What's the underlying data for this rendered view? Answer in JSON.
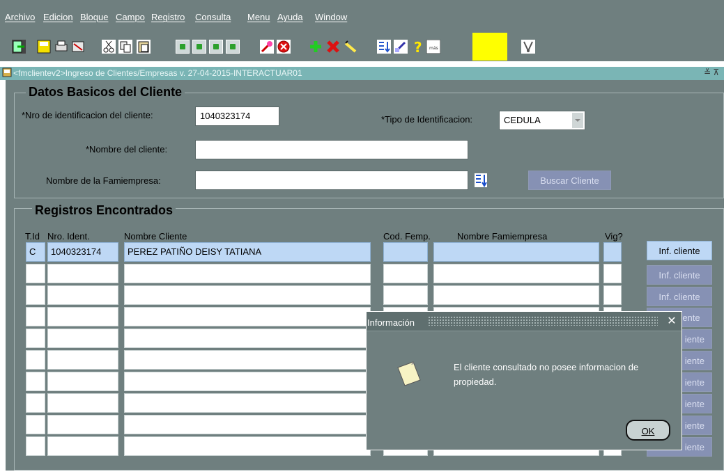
{
  "menu": [
    "Archivo",
    "Edicion",
    "Bloque",
    "Campo",
    "Registro",
    "Consulta",
    "Menu",
    "Ayuda",
    "Window"
  ],
  "toolbar_icons": [
    "exit-icon",
    "save-icon",
    "print-icon",
    "clear-icon",
    "cut-icon",
    "copy-icon",
    "paste-icon",
    "first-record-icon",
    "previous-block-icon",
    "next-block-icon",
    "last-record-icon",
    "enter-query-icon",
    "cancel-query-icon",
    "insert-record-icon",
    "delete-record-icon",
    "edit-icon",
    "list-icon",
    "notes-icon",
    "help-icon",
    "more-icon",
    "highlight-box",
    "tools-icon"
  ],
  "window": {
    "title": "<fmclientev2>Ingreso de Clientes/Empresas v. 27-04-2015-INTERACTUAR01",
    "controls": "≚ ⊼"
  },
  "basic": {
    "section_title": "Datos Basicos del Cliente",
    "id_label": "*Nro de identificacion del cliente:",
    "id_value": "1040323174",
    "tipo_label": "*Tipo de Identificacion:",
    "tipo_value": "CEDULA",
    "nombre_label": "*Nombre del cliente:",
    "nombre_value": "",
    "famiempresa_label": "Nombre de la Famiempresa:",
    "famiempresa_value": "",
    "buscar_button": "Buscar Cliente"
  },
  "registros": {
    "section_title": "Registros Encontrados",
    "headers": [
      "T.Id",
      "Nro. Ident.",
      "Nombre Cliente",
      "Cod. Femp.",
      "Nombre Famiempresa",
      "Vig?"
    ],
    "rows": [
      {
        "tid": "C",
        "nro": "1040323174",
        "nombre": "PEREZ PATIÑO DEISY TATIANA",
        "cod": "",
        "famiempresa": "",
        "vig": ""
      }
    ],
    "inf_button": "Inf. cliente",
    "visible_inf_top": [
      "Inf. cliente",
      "Inf. cliente",
      "Inf. cliente"
    ],
    "visible_inf_partial": [
      "iente",
      "iente",
      "iente",
      "iente",
      "iente",
      "iente",
      "iente",
      "iente"
    ]
  },
  "dialog": {
    "title": "Información",
    "close": "✕",
    "message": "El cliente consultado no posee informacion de propiedad.",
    "ok": "OK"
  },
  "colors": {
    "chrome": "#6f7f7f",
    "title_bar": "#7ab5b5",
    "selection": "#bed8f5",
    "button_disabled": "#8691b4",
    "highlight": "#ffff00"
  }
}
